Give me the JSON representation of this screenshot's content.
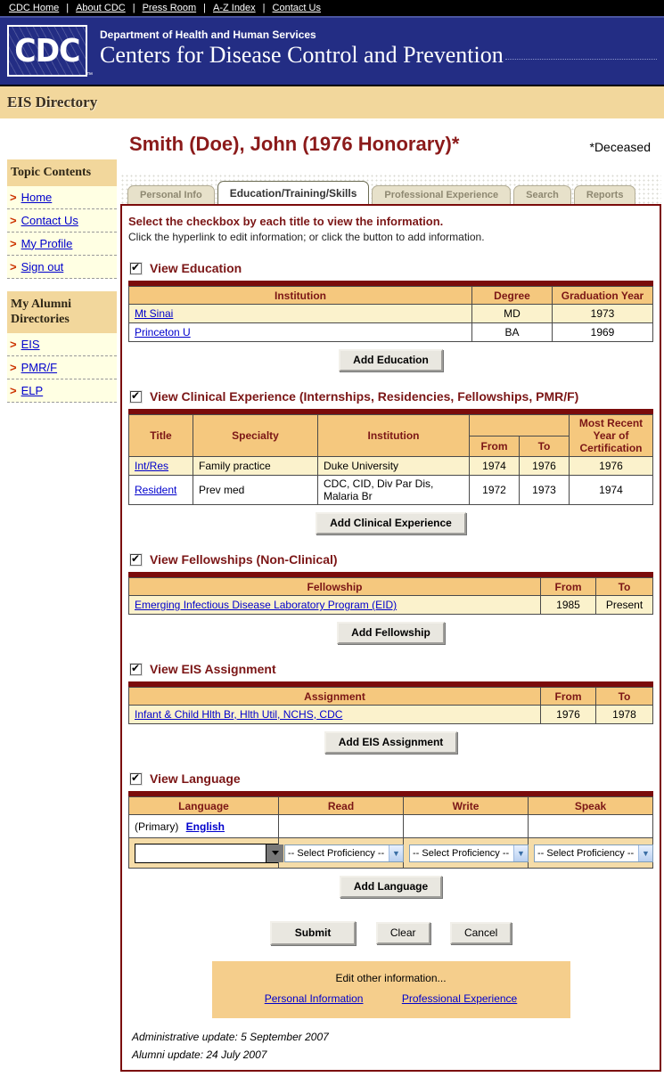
{
  "colors": {
    "navy": "#232D84",
    "maroon_border": "#7B0B0B",
    "maroon_text": "#7B1616",
    "title_red": "#8B1A1A",
    "tan_banner": "#F2D79C",
    "table_header_orange": "#F5C87E",
    "row_yellow": "#FBF2CC",
    "link_blue": "#0000CC",
    "sidebar_yellow": "#FFFFE3",
    "edit_box_tan": "#F5CE8C"
  },
  "top_bar": {
    "links": [
      "CDC Home",
      "About CDC",
      "Press Room",
      "A-Z Index",
      "Contact Us"
    ]
  },
  "header": {
    "logo": "CDC",
    "tm": "™",
    "dept": "Department of Health and Human Services",
    "org": "Centers for Disease Control and Prevention"
  },
  "banner": {
    "title": "EIS Directory"
  },
  "sidebar": {
    "sections": [
      {
        "title": "Topic Contents",
        "items": [
          "Home",
          "Contact Us",
          "My Profile",
          "Sign out"
        ]
      },
      {
        "title": "My Alumni Directories",
        "items": [
          "EIS",
          "PMR/F",
          "ELP"
        ]
      }
    ],
    "arrow": ">"
  },
  "page": {
    "title": "Smith (Doe), John (1976 Honorary)*",
    "deceased_note": "*Deceased"
  },
  "tabs": [
    {
      "label": "Personal Info",
      "active": false
    },
    {
      "label": "Education/Training/Skills",
      "active": true
    },
    {
      "label": "Professional Experience",
      "active": false
    },
    {
      "label": "Search",
      "active": false
    },
    {
      "label": "Reports",
      "active": false
    }
  ],
  "instructions": {
    "heading": "Select the checkbox by each title to view the information.",
    "subtext": "Click the hyperlink to edit information; or click the button to add information."
  },
  "education": {
    "section_title": "View Education",
    "checked": true,
    "columns": [
      "Institution",
      "Degree",
      "Graduation Year"
    ],
    "rows": [
      {
        "institution": "Mt Sinai",
        "degree": "MD",
        "year": "1973"
      },
      {
        "institution": "Princeton U",
        "degree": "BA",
        "year": "1969"
      }
    ],
    "add_button": "Add Education"
  },
  "clinical": {
    "section_title": "View Clinical Experience (Internships, Residencies, Fellowships, PMR/F)",
    "checked": true,
    "columns": {
      "title": "Title",
      "specialty": "Specialty",
      "institution": "Institution",
      "from": "From",
      "to": "To",
      "cert": "Most Recent Year of Certification"
    },
    "rows": [
      {
        "title": "Int/Res",
        "specialty": "Family practice",
        "institution": "Duke University",
        "from": "1974",
        "to": "1976",
        "cert": "1976"
      },
      {
        "title": "Resident",
        "specialty": "Prev med",
        "institution": "CDC, CID, Div Par Dis, Malaria Br",
        "from": "1972",
        "to": "1973",
        "cert": "1974"
      }
    ],
    "add_button": "Add Clinical Experience"
  },
  "fellowships": {
    "section_title": "View Fellowships (Non-Clinical)",
    "checked": true,
    "columns": [
      "Fellowship",
      "From",
      "To"
    ],
    "rows": [
      {
        "fellowship": "Emerging Infectious Disease Laboratory Program (EID)",
        "from": "1985",
        "to": "Present"
      }
    ],
    "add_button": "Add Fellowship"
  },
  "eis": {
    "section_title": "View EIS Assignment",
    "checked": true,
    "columns": [
      "Assignment",
      "From",
      "To"
    ],
    "rows": [
      {
        "assignment": "Infant & Child Hlth Br, Hlth Util, NCHS, CDC",
        "from": "1976",
        "to": "1978"
      }
    ],
    "add_button": "Add EIS Assignment"
  },
  "language": {
    "section_title": "View Language",
    "checked": true,
    "columns": [
      "Language",
      "Read",
      "Write",
      "Speak"
    ],
    "rows": [
      {
        "prefix": "(Primary)",
        "language": "English"
      }
    ],
    "new_language_value": "",
    "select_placeholder": "-- Select Proficiency --",
    "add_button": "Add Language"
  },
  "form_buttons": {
    "submit": "Submit",
    "clear": "Clear",
    "cancel": "Cancel"
  },
  "edit_box": {
    "heading": "Edit other information...",
    "links": [
      "Personal Information",
      "Professional Experience"
    ]
  },
  "footer": {
    "admin_update": "Administrative update: 5 September 2007",
    "alumni_update": "Alumni update: 24 July 2007"
  }
}
